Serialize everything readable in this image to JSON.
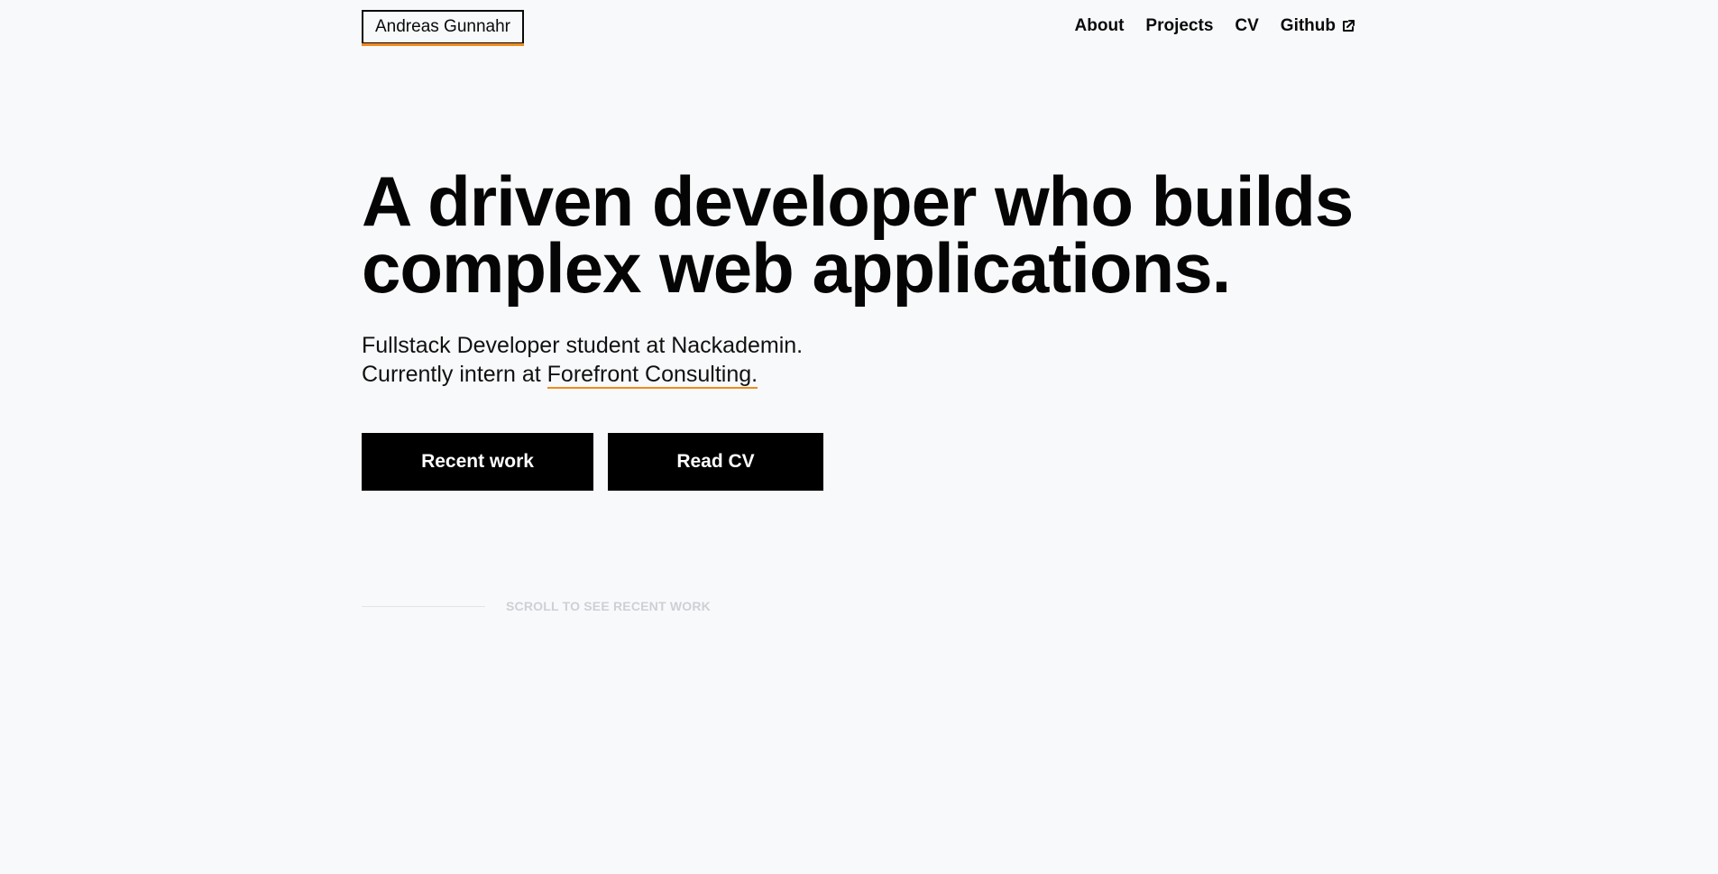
{
  "header": {
    "logo_text": "Andreas Gunnahr",
    "nav": [
      {
        "label": "About"
      },
      {
        "label": "Projects"
      },
      {
        "label": "CV"
      },
      {
        "label": "Github",
        "icon": "external-link-icon"
      }
    ]
  },
  "hero": {
    "title": "A driven developer who builds complex web applications.",
    "subtitle_line1": "Fullstack Developer student at Nackademin.",
    "subtitle_line2_prefix": "Currently intern at ",
    "company_link": "Forefront Consulting.",
    "buttons": {
      "recent_work": "Recent work",
      "read_cv": "Read CV"
    }
  },
  "scroll_hint": {
    "text": "SCROLL TO SEE RECENT WORK"
  },
  "colors": {
    "background": "#f8f9fb",
    "accent": "#f08a1c",
    "text": "#0a0a0a",
    "button_bg": "#000000",
    "button_text": "#ffffff",
    "muted": "#cdd0d5"
  }
}
